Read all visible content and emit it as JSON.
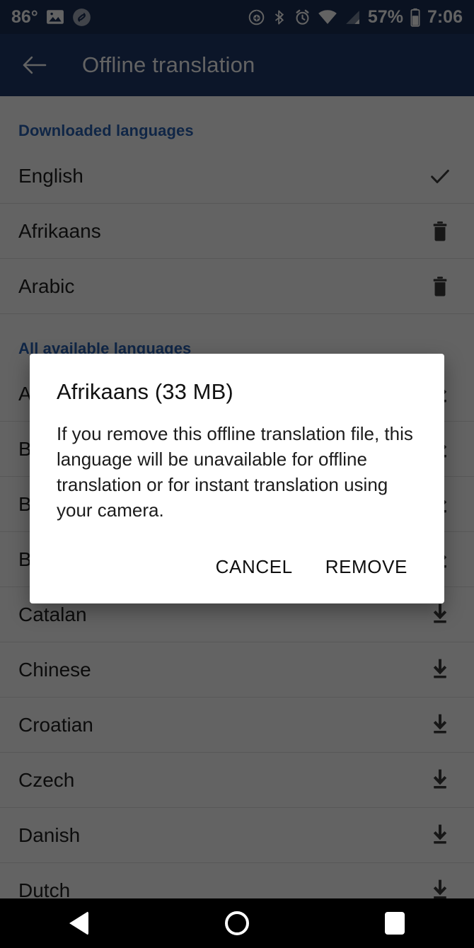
{
  "status_bar": {
    "temperature": "86°",
    "time": "7:06",
    "battery_percent": "57%",
    "left_icons": [
      "photo-icon",
      "shazam-icon"
    ],
    "right_icons": [
      "battery-saver-icon",
      "bluetooth-icon",
      "alarm-icon",
      "wifi-icon",
      "cellular-signal-icon",
      "battery-icon"
    ],
    "background_color": "#1b2f57"
  },
  "app_bar": {
    "title": "Offline translation",
    "back_label": "Back",
    "background_color": "#20396a"
  },
  "sections": [
    {
      "header": "Downloaded languages",
      "header_color": "#2962b5",
      "rows": [
        {
          "label": "English",
          "action": "check"
        },
        {
          "label": "Afrikaans",
          "action": "delete"
        },
        {
          "label": "Arabic",
          "action": "delete"
        }
      ]
    },
    {
      "header": "All available languages",
      "header_color": "#2962b5",
      "rows": [
        {
          "label": "Albanian",
          "action": "download"
        },
        {
          "label": "Belarusian",
          "action": "download"
        },
        {
          "label": "Bengali",
          "action": "download"
        },
        {
          "label": "Bulgarian",
          "action": "download"
        },
        {
          "label": "Catalan",
          "action": "download"
        },
        {
          "label": "Chinese",
          "action": "download"
        },
        {
          "label": "Croatian",
          "action": "download"
        },
        {
          "label": "Czech",
          "action": "download"
        },
        {
          "label": "Danish",
          "action": "download"
        },
        {
          "label": "Dutch",
          "action": "download"
        }
      ]
    }
  ],
  "dialog": {
    "title": "Afrikaans (33 MB)",
    "message": "If you remove this offline translation file, this language will be unavailable for offline translation or for instant translation using your camera.",
    "cancel_label": "CANCEL",
    "confirm_label": "REMOVE"
  },
  "nav_bar": {
    "back_label": "Back",
    "home_label": "Home",
    "recents_label": "Recents",
    "background_color": "#000000"
  }
}
